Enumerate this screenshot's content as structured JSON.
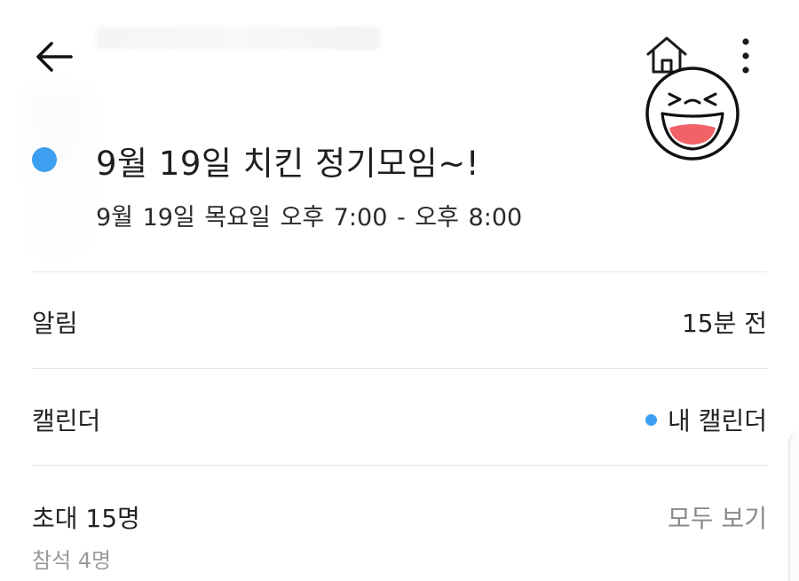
{
  "topbar": {
    "back_icon": "arrow-left-icon",
    "home_icon": "home-icon",
    "more_icon": "more-vertical-icon",
    "sticker": "laughing-face-sticker"
  },
  "event": {
    "color": "#3d9ff0",
    "title": "9월 19일 치킨 정기모임~!",
    "time": "9월 19일 목요일  오후 7:00 - 오후 8:00"
  },
  "rows": {
    "alarm": {
      "label": "알림",
      "value": "15분 전"
    },
    "calendar": {
      "label": "캘린더",
      "value": "내 캘린더",
      "dot_color": "#3d9ff0"
    },
    "invite": {
      "label": "초대 15명",
      "value": "모두 보기",
      "sub": "참석 4명"
    }
  }
}
